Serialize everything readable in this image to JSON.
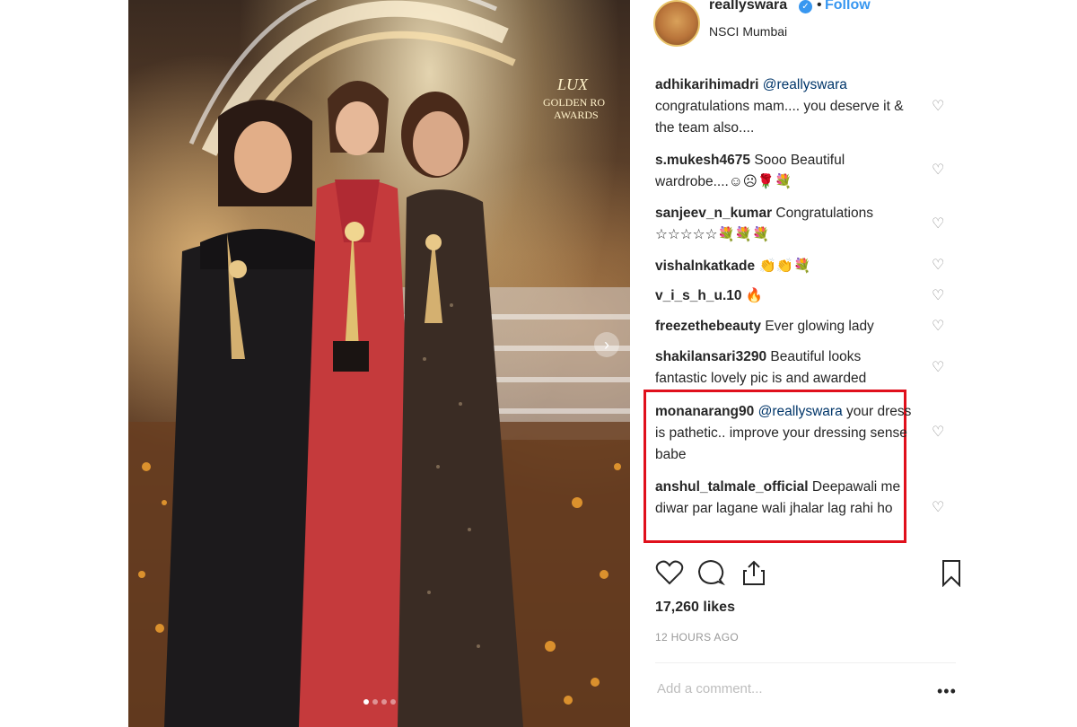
{
  "post": {
    "username": "reallyswara",
    "verified_icon": "verified-badge-icon",
    "separator": "•",
    "follow_label": "Follow",
    "location": "NSCI Mumbai",
    "image_description": "Three women holding trophies on stage at an awards night",
    "stage_sign_lines": [
      "LUX",
      "GOLDEN RO",
      "AWARDS"
    ],
    "carousel_dot_count": 4,
    "carousel_active_index": 0
  },
  "comments": [
    {
      "user": "adhikarihimadri",
      "mention": "@reallyswara",
      "text": "congratulations mam.... you deserve it & the team also...."
    },
    {
      "user": "s.mukesh4675",
      "mention": "",
      "text": "Sooo Beautiful wardrobe....☺☹🌹💐"
    },
    {
      "user": "sanjeev_n_kumar",
      "mention": "",
      "text": "Congratulations ☆☆☆☆☆💐💐💐"
    },
    {
      "user": "vishalnkatkade",
      "mention": "",
      "text": "👏👏💐"
    },
    {
      "user": "v_i_s_h_u.10",
      "mention": "",
      "text": "🔥"
    },
    {
      "user": "freezethebeauty",
      "mention": "",
      "text": "Ever glowing lady"
    },
    {
      "user": "shakilansari3290",
      "mention": "",
      "text": "Beautiful looks fantastic lovely pic is and awarded"
    },
    {
      "user": "monanarang90",
      "mention": "@reallyswara",
      "text": "your dress is pathetic.. improve your dressing sense babe"
    },
    {
      "user": "anshul_talmale_official",
      "mention": "",
      "text": "Deepawali me diwar par lagane wali jhalar lag rahi ho"
    }
  ],
  "actions": {
    "icons": [
      "heart-icon",
      "comment-icon",
      "share-icon",
      "bookmark-icon"
    ],
    "likes": "17,260 likes",
    "time": "12 HOURS AGO",
    "add_comment_placeholder": "Add a comment...",
    "more_label": "•••"
  },
  "colors": {
    "follow": "#3897f0",
    "highlight": "#e0101c",
    "mention": "#003569"
  }
}
